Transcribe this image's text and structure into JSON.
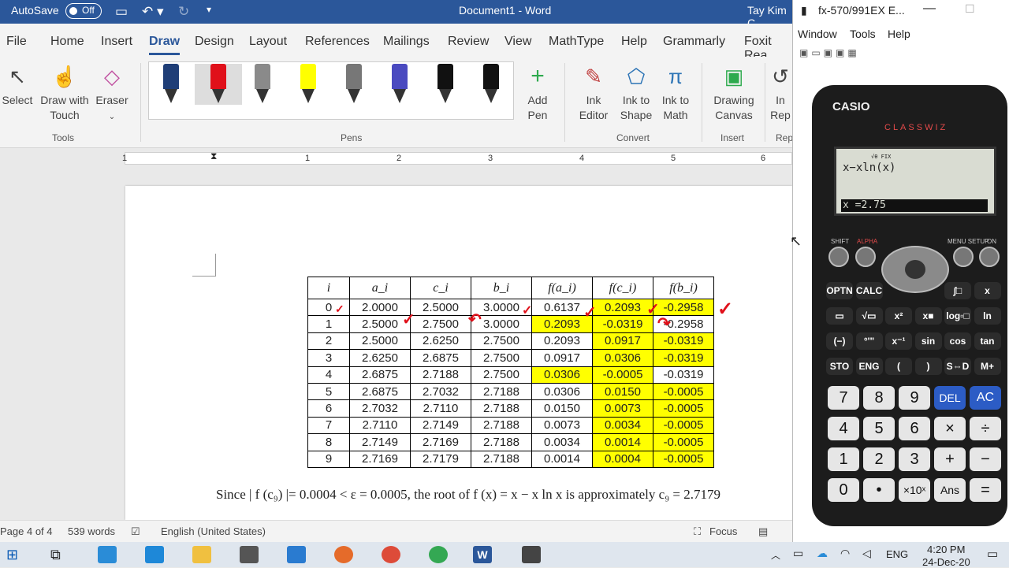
{
  "titlebar": {
    "autosave": "AutoSave",
    "toggle": "Off",
    "doc_title": "Document1  -  Word",
    "user": "Tay Kim C"
  },
  "tabs": [
    "File",
    "Home",
    "Insert",
    "Draw",
    "Design",
    "Layout",
    "References",
    "Mailings",
    "Review",
    "View",
    "MathType",
    "Help",
    "Grammarly",
    "Foxit Rea"
  ],
  "ribbon": {
    "select": "Select",
    "draw_touch": "Draw with Touch",
    "eraser": "Eraser",
    "tools_group": "Tools",
    "pens_group": "Pens",
    "add_pen": "Add Pen",
    "ink_editor": "Ink Editor",
    "ink_to_shape": "Ink to Shape",
    "ink_to_math": "Ink to Math",
    "convert_group": "Convert",
    "drawing_canvas": "Drawing Canvas",
    "insert_group": "Insert",
    "replay_partial": "In Rep",
    "rep_group": "Rep"
  },
  "pens": [
    {
      "color": "#1f3e77"
    },
    {
      "color": "#e0101a"
    },
    {
      "color": "#8a8a8a"
    },
    {
      "color": "#ffff00"
    },
    {
      "color": "#777777"
    },
    {
      "color": "#4a4ac0"
    },
    {
      "color": "#111111"
    },
    {
      "color": "#111111"
    }
  ],
  "ruler": [
    "1",
    "1",
    "2",
    "3",
    "4",
    "5",
    "6"
  ],
  "table": {
    "headers": [
      "i",
      "a_i",
      "c_i",
      "b_i",
      "f(a_i)",
      "f(c_i)",
      "f(b_i)"
    ],
    "rows": [
      [
        "0",
        "2.0000",
        "2.5000",
        "3.0000",
        "0.6137",
        "0.2093",
        "-0.2958"
      ],
      [
        "1",
        "2.5000",
        "2.7500",
        "3.0000",
        "0.2093",
        "-0.0319",
        "-0.2958"
      ],
      [
        "2",
        "2.5000",
        "2.6250",
        "2.7500",
        "0.2093",
        "0.0917",
        "-0.0319"
      ],
      [
        "3",
        "2.6250",
        "2.6875",
        "2.7500",
        "0.0917",
        "0.0306",
        "-0.0319"
      ],
      [
        "4",
        "2.6875",
        "2.7188",
        "2.7500",
        "0.0306",
        "-0.0005",
        "-0.0319"
      ],
      [
        "5",
        "2.6875",
        "2.7032",
        "2.7188",
        "0.0306",
        "0.0150",
        "-0.0005"
      ],
      [
        "6",
        "2.7032",
        "2.7110",
        "2.7188",
        "0.0150",
        "0.0073",
        "-0.0005"
      ],
      [
        "7",
        "2.7110",
        "2.7149",
        "2.7188",
        "0.0073",
        "0.0034",
        "-0.0005"
      ],
      [
        "8",
        "2.7149",
        "2.7169",
        "2.7188",
        "0.0034",
        "0.0014",
        "-0.0005"
      ],
      [
        "9",
        "2.7169",
        "2.7179",
        "2.7188",
        "0.0014",
        "0.0004",
        "-0.0005"
      ]
    ],
    "highlight": [
      [
        0,
        5
      ],
      [
        0,
        6
      ],
      [
        1,
        4
      ],
      [
        1,
        5
      ],
      [
        2,
        5
      ],
      [
        2,
        6
      ],
      [
        3,
        5
      ],
      [
        3,
        6
      ],
      [
        4,
        4
      ],
      [
        4,
        5
      ],
      [
        5,
        5
      ],
      [
        5,
        6
      ],
      [
        6,
        5
      ],
      [
        6,
        6
      ],
      [
        7,
        5
      ],
      [
        7,
        6
      ],
      [
        8,
        5
      ],
      [
        8,
        6
      ],
      [
        9,
        5
      ],
      [
        9,
        6
      ]
    ],
    "highlight_color": "#ffff00"
  },
  "sentence": "Since | f (c₉) |= 0.0004 < ε = 0.0005,  the root of  f (x) = x − x ln x  is approximately  c₉ = 2.7179",
  "status": {
    "page": "Page 4 of 4",
    "words": "539 words",
    "language": "English (United States)",
    "focus": "Focus"
  },
  "calc_window": {
    "title": "fx-570/991EX E...",
    "menu": [
      "Window",
      "Tools",
      "Help"
    ]
  },
  "calc": {
    "brand": "CASIO",
    "model": "CLASSWIZ",
    "indicators": "√θ  FIX",
    "expression": "x−xln(x)",
    "result": "x =2.75",
    "top_labels": {
      "shift": "SHIFT",
      "alpha": "ALPHA",
      "menu": "MENU SETUP",
      "on": "ON"
    },
    "func_rows": [
      [
        "OPTN",
        "CALC",
        "",
        "",
        "∫□",
        "x"
      ],
      [
        "▭",
        "√▭",
        "x²",
        "x■",
        "log▫□",
        "ln"
      ],
      [
        "(−)",
        "°'\"",
        "x⁻¹",
        "sin",
        "cos",
        "tan"
      ],
      [
        "STO",
        "ENG",
        "(",
        ")",
        "S⇔D",
        "M+"
      ]
    ],
    "num_rows": [
      [
        "7",
        "8",
        "9",
        "DEL",
        "AC"
      ],
      [
        "4",
        "5",
        "6",
        "×",
        "÷"
      ],
      [
        "1",
        "2",
        "3",
        "+",
        "−"
      ],
      [
        "0",
        "•",
        "×10ˣ",
        "Ans",
        "="
      ]
    ]
  },
  "taskbar": {
    "time": "4:20 PM",
    "date": "24-Dec-20",
    "lang": "ENG"
  }
}
